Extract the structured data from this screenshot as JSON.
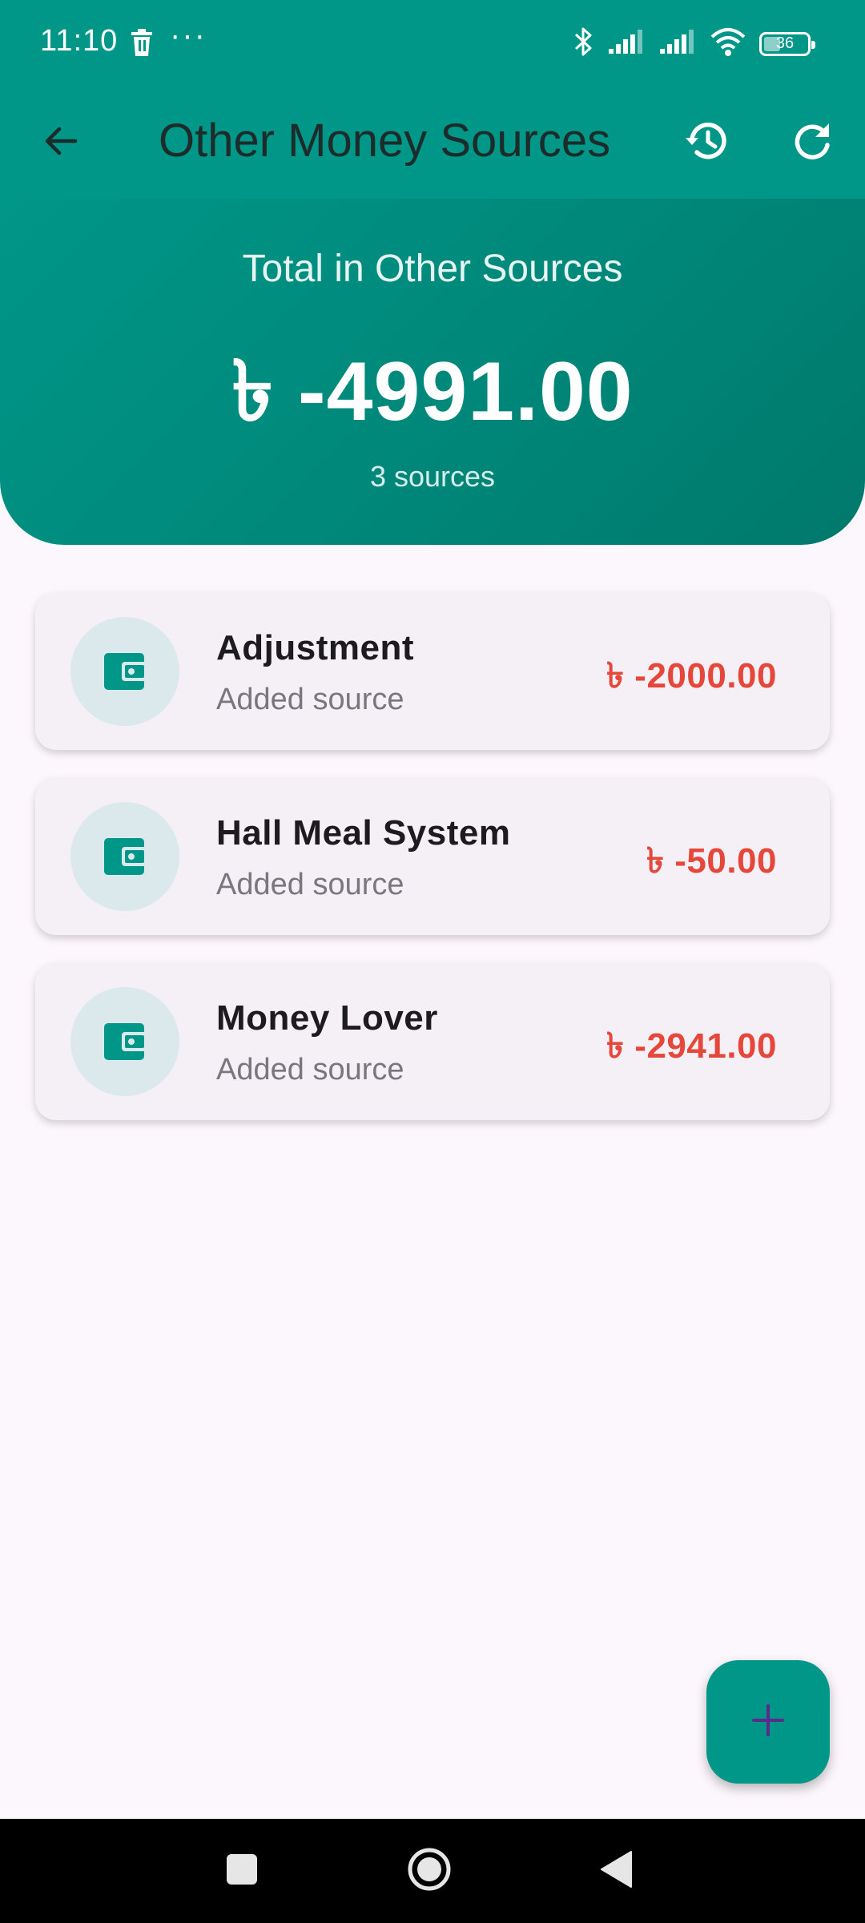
{
  "status_bar": {
    "time": "11:10",
    "battery": "36",
    "icons": [
      "trash-icon",
      "more-icon",
      "bluetooth-icon",
      "signal-icon",
      "signal-icon",
      "wifi-icon",
      "battery-icon"
    ]
  },
  "app_bar": {
    "title": "Other Money Sources",
    "back_icon": "arrow-back-icon",
    "history_icon": "history-icon",
    "refresh_icon": "refresh-icon"
  },
  "summary": {
    "label": "Total in Other Sources",
    "amount": "৳ -4991.00",
    "count": "3 sources"
  },
  "sources": [
    {
      "name": "Adjustment",
      "subtitle": "Added source",
      "amount": "৳ -2000.00",
      "icon": "wallet-icon"
    },
    {
      "name": "Hall Meal System",
      "subtitle": "Added source",
      "amount": "৳ -50.00",
      "icon": "wallet-icon"
    },
    {
      "name": "Money Lover",
      "subtitle": "Added source",
      "amount": "৳ -2941.00",
      "icon": "wallet-icon"
    }
  ],
  "fab": {
    "icon": "plus-icon"
  },
  "colors": {
    "primary": "#009688",
    "negative_amount": "#e5473b",
    "fab_icon": "#5b2b8c",
    "background": "#fcf7fc"
  }
}
